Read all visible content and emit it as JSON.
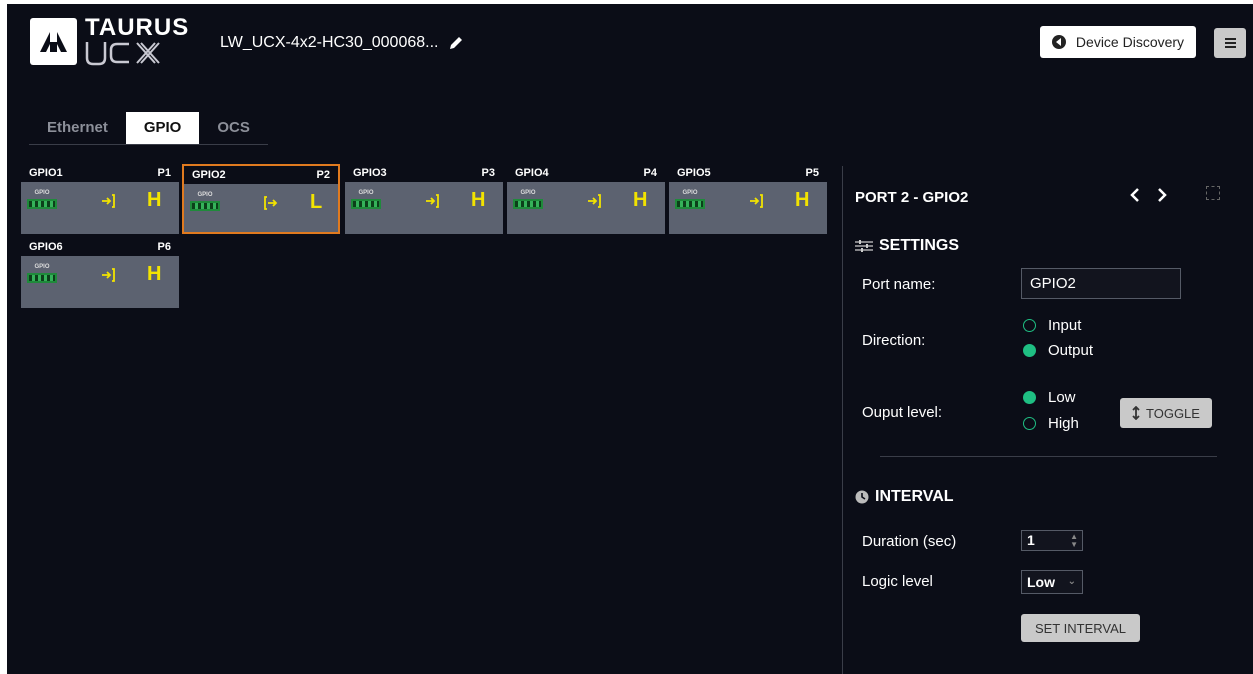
{
  "header": {
    "logo_top": "TAURUS",
    "logo_bottom": "UCX",
    "device_name": "LW_UCX-4x2-HC30_000068...",
    "discovery_label": "Device Discovery"
  },
  "tabs": [
    {
      "label": "Ethernet",
      "active": false
    },
    {
      "label": "GPIO",
      "active": true
    },
    {
      "label": "OCS",
      "active": false
    }
  ],
  "ports": [
    {
      "name": "GPIO1",
      "port": "P1",
      "connector": "GPIO",
      "direction": "input",
      "level": "H"
    },
    {
      "name": "GPIO2",
      "port": "P2",
      "connector": "GPIO",
      "direction": "output",
      "level": "L",
      "selected": true
    },
    {
      "name": "GPIO3",
      "port": "P3",
      "connector": "GPIO",
      "direction": "input",
      "level": "H"
    },
    {
      "name": "GPIO4",
      "port": "P4",
      "connector": "GPIO",
      "direction": "input",
      "level": "H"
    },
    {
      "name": "GPIO5",
      "port": "P5",
      "connector": "GPIO",
      "direction": "input",
      "level": "H"
    },
    {
      "name": "GPIO6",
      "port": "P6",
      "connector": "GPIO",
      "direction": "input",
      "level": "H"
    }
  ],
  "panel": {
    "title": "PORT 2 - GPIO2",
    "settings_title": "SETTINGS",
    "port_name_label": "Port name:",
    "port_name_value": "GPIO2",
    "direction_label": "Direction:",
    "direction_options": [
      "Input",
      "Output"
    ],
    "direction_selected": "Output",
    "output_level_label": "Ouput level:",
    "output_level_options": [
      "Low",
      "High"
    ],
    "output_level_selected": "Low",
    "toggle_label": "TOGGLE",
    "interval_title": "INTERVAL",
    "duration_label": "Duration (sec)",
    "duration_value": "1",
    "logic_level_label": "Logic level",
    "logic_level_value": "Low",
    "set_interval_label": "SET INTERVAL"
  },
  "colors": {
    "background": "#0b0d17",
    "tile": "#5c6270",
    "level_text": "#f2e300",
    "selected_border": "#e07a1f",
    "radio": "#1fbf83"
  }
}
